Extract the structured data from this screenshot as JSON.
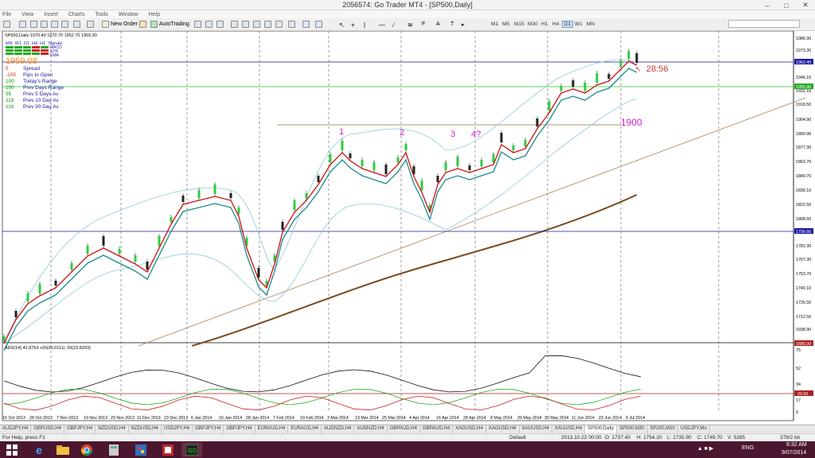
{
  "window": {
    "title": "2056574: Go Trader MT4 - [SP500,Daily]"
  },
  "menu": [
    "File",
    "View",
    "Insert",
    "Charts",
    "Tools",
    "Window",
    "Help"
  ],
  "toolbar": {
    "new_order": "New Order",
    "autotrading": "AutoTrading",
    "timeframes": [
      "M1",
      "M5",
      "M15",
      "M30",
      "H1",
      "H4",
      "D1",
      "W1",
      "MN"
    ],
    "active_timeframe": "D1"
  },
  "chart": {
    "header": "SP500,Daily  1970.40 1970.70 1952.70 1955.90",
    "info_panel": {
      "tf_labels": [
        "MN",
        "W1",
        "D1",
        "H4",
        "H1",
        "Signals"
      ],
      "signal_rows": [
        "MACD",
        "STR",
        "EMA"
      ],
      "price": "1959.08",
      "rows": [
        {
          "value": "5",
          "label": "Spread",
          "color": "#cc3300"
        },
        {
          "value": "-105",
          "label": "Pips to Open",
          "color": "#cc3300"
        },
        {
          "value": "100",
          "label": "Today's Range",
          "color": "#009900"
        },
        {
          "value": "100",
          "label": "Prev Days Range",
          "color": "#009900"
        },
        {
          "value": "95",
          "label": "Prev 5 Days Av",
          "color": "#009900"
        },
        {
          "value": "119",
          "label": "Prev 10 Day Av",
          "color": "#009900"
        },
        {
          "value": "116",
          "label": "Prev 30 Day Av",
          "color": "#009900"
        }
      ]
    },
    "annotations": {
      "wave1": "1",
      "wave2": "2",
      "wave3": "3",
      "wave4": "4?",
      "level": "1900",
      "countdown": "28:56"
    },
    "price_axis": [
      "1986.90",
      "1973.30",
      "1946.10",
      "1932.10",
      "1918.50",
      "1904.90",
      "1890.90",
      "1877.30",
      "1863.70",
      "1849.70",
      "1836.10",
      "1822.50",
      "1808.50",
      "1781.30",
      "1767.30",
      "1753.70",
      "1740.10",
      "1726.50",
      "1712.50",
      "1698.90"
    ],
    "price_tags": [
      {
        "label": "1962.40",
        "bg": "#1a1aa0"
      },
      {
        "label": "1955.90",
        "bg": "#22aa22"
      },
      {
        "label": "1796.66",
        "bg": "#1a1aa0"
      },
      {
        "label": "1685.00",
        "bg": "#aa2222"
      }
    ],
    "date_axis": [
      "16 Oct 2013",
      "28 Oct 2013",
      "7 Nov 2013",
      "19 Nov 2013",
      "29 Nov 2013",
      "11 Dec 2013",
      "23 Dec 2013",
      "6 Jan 2014",
      "16 Jan 2014",
      "28 Jan 2014",
      "7 Feb 2014",
      "19 Feb 2014",
      "3 Mar 2014",
      "13 Mar 2014",
      "25 Mar 2014",
      "4 Apr 2014",
      "16 Apr 2014",
      "28 Apr 2014",
      "8 May 2014",
      "20 May 2014",
      "30 May 2014",
      "11 Jun 2014",
      "23 Jun 2014",
      "3 Jul 2014"
    ],
    "adx_header": "ADX(14) 42.8763 +DI(20.0111) -DI(22.8203)",
    "adx_axis": [
      "75",
      "52",
      "34",
      "17",
      "0"
    ],
    "adx_tag": "20.00"
  },
  "tabs": [
    "AUDJPY,H4",
    "GBPUSD,H4",
    "GBPJPY,H4",
    "NZDUSD,H4",
    "NZDUSD,H4",
    "USDJPY,H4",
    "GBPJPY,H4",
    "GBPJPY,H4",
    "EURAUD,H4",
    "EURAUD,H4",
    "AUDNZD,H4",
    "AUDNZD,H4",
    "GBPAUD,H4",
    "GBPAUD,H4",
    "XAGUSD,H4",
    "XAGUSD,H4",
    "XAUUSD,H4",
    "XAUUSD,H4",
    "SP500,Daily",
    "SP500,M30",
    "SP200,M30",
    "USDJPY,Mo"
  ],
  "active_tab": "SP500,Daily",
  "status": {
    "help": "For Help, press F1",
    "profile": "Default",
    "datetime": "2013.10.22 00:00",
    "open": "O: 1737.40",
    "high": "H: 1754.20",
    "low": "L: 1735.90",
    "close": "C: 1749.70",
    "volume": "V: 5285",
    "traffic": "378/2 kb"
  },
  "taskbar": {
    "lang": "ENG",
    "time": "6:32 AM",
    "date": "9/07/2014"
  }
}
